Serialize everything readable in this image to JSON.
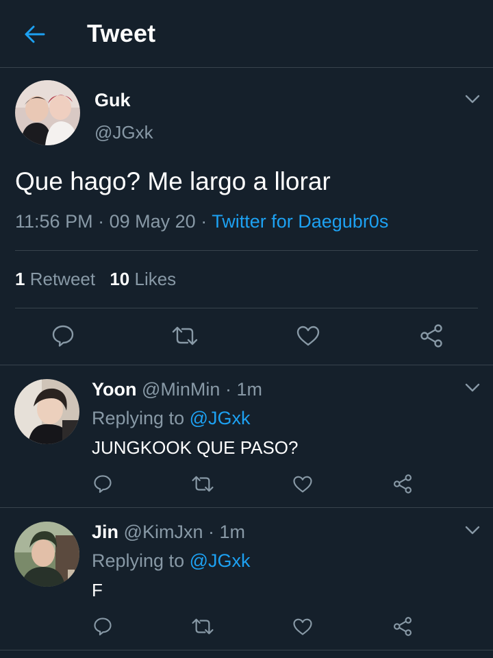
{
  "header": {
    "title": "Tweet"
  },
  "tweet": {
    "name": "Guk",
    "handle": "@JGxk",
    "text": "Que hago? Me largo a llorar",
    "time": "11:56 PM",
    "date": "09 May 20",
    "sep": "·",
    "source": "Twitter for Daegubr0s",
    "retweet_count": "1",
    "retweet_label": "Retweet",
    "like_count": "10",
    "like_label": "Likes"
  },
  "replies": [
    {
      "name": "Yoon",
      "handle": "@MinMin",
      "time": "1m",
      "replying_label": "Replying to",
      "replying_to": "@JGxk",
      "text": "JUNGKOOK QUE PASO?"
    },
    {
      "name": "Jin",
      "handle": "@KimJxn",
      "time": "1m",
      "replying_label": "Replying to",
      "replying_to": "@JGxk",
      "text": "F"
    }
  ],
  "icons": {
    "back": "arrow-left-icon",
    "caret": "chevron-down-icon",
    "reply": "comment-icon",
    "retweet": "retweet-icon",
    "like": "heart-icon",
    "share": "share-icon"
  },
  "colors": {
    "background": "#15202b",
    "accent": "#1da1f2",
    "secondary_text": "#8899a6",
    "divider": "#38444d"
  }
}
